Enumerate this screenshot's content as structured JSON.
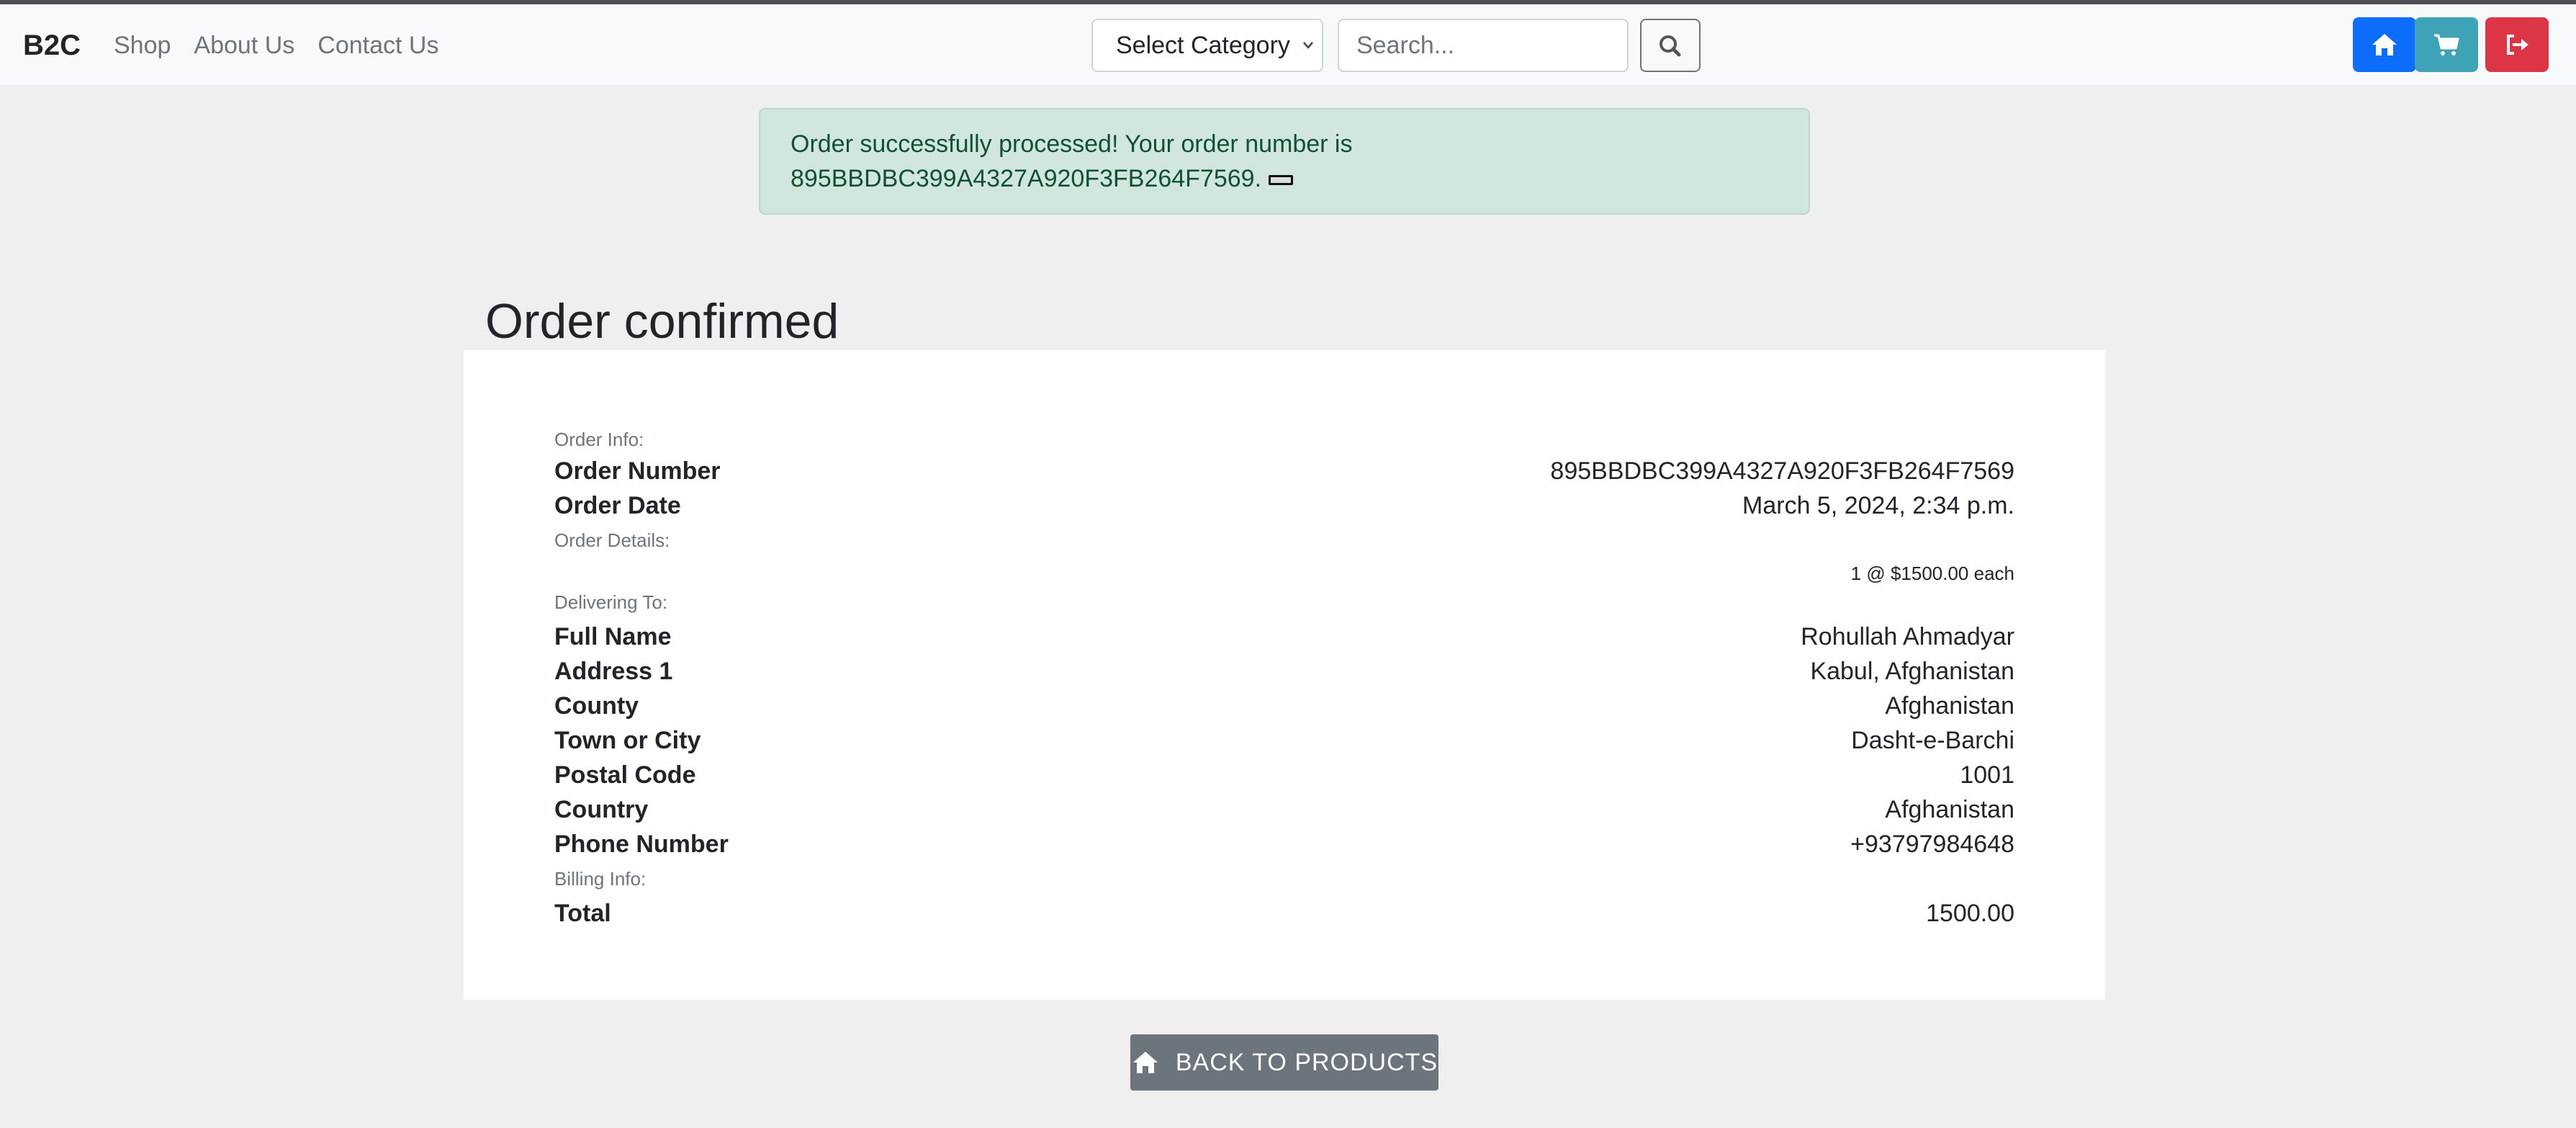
{
  "nav": {
    "brand": "B2C",
    "links": [
      "Shop",
      "About Us",
      "Contact Us"
    ],
    "category_select": "Select Category",
    "search_placeholder": "Search..."
  },
  "alert": {
    "line1": "Order successfully processed! Your order number is",
    "line2": "895BBDBC399A4327A920F3FB264F7569."
  },
  "page_title": "Order confirmed",
  "order": {
    "sections": {
      "order_info": "Order Info:",
      "order_details": "Order Details:",
      "delivering_to": "Delivering To:",
      "billing_info": "Billing Info:"
    },
    "order_number": {
      "label": "Order Number",
      "value": "895BBDBC399A4327A920F3FB264F7569"
    },
    "order_date": {
      "label": "Order Date",
      "value": "March 5, 2024, 2:34 p.m."
    },
    "item_line": "1 @ $1500.00 each",
    "delivery": [
      {
        "label": "Full Name",
        "value": "Rohullah Ahmadyar"
      },
      {
        "label": "Address 1",
        "value": "Kabul, Afghanistan"
      },
      {
        "label": "County",
        "value": "Afghanistan"
      },
      {
        "label": "Town or City",
        "value": "Dasht-e-Barchi"
      },
      {
        "label": "Postal Code",
        "value": "1001"
      },
      {
        "label": "Country",
        "value": "Afghanistan"
      },
      {
        "label": "Phone Number",
        "value": "+93797984648"
      }
    ],
    "total": {
      "label": "Total",
      "value": "1500.00"
    }
  },
  "back_button": "BACK TO PRODUCTS",
  "colors": {
    "home_button": "#0d6efd",
    "cart_button": "#3fa3b8",
    "logout_button": "#dc3545",
    "alert_bg": "#d1e7dd",
    "back_button": "#6c757d"
  },
  "icons": [
    "search-icon",
    "home-icon",
    "cart-icon",
    "logout-icon",
    "close-icon"
  ]
}
